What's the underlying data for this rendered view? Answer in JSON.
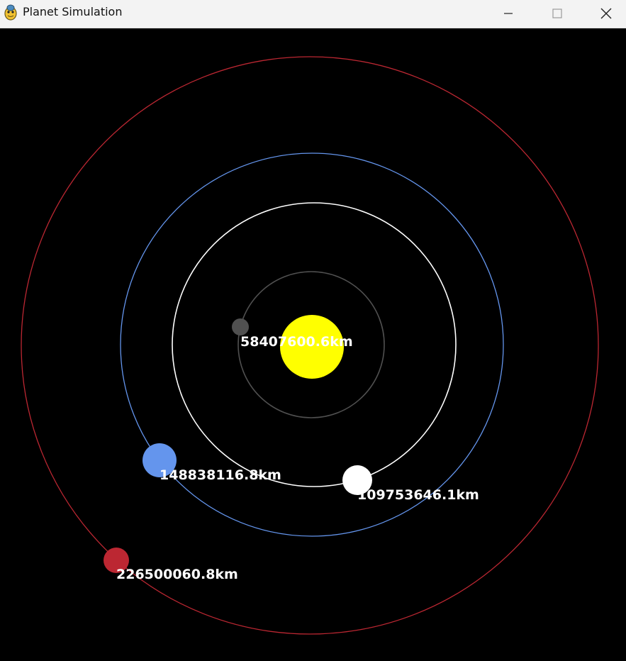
{
  "window": {
    "title": "Planet Simulation",
    "controls": {
      "minimize": "minimize",
      "maximize": "maximize",
      "close": "close"
    }
  },
  "simulation": {
    "background": "#000000",
    "sun": {
      "color": "#ffff00"
    },
    "planets": [
      {
        "id": "mercury",
        "color": "#505050",
        "orbit_color": "#505050",
        "distance_label": "58407600.6km"
      },
      {
        "id": "venus",
        "color": "#ffffff",
        "orbit_color": "#ffffff",
        "distance_label": "109753646.1km"
      },
      {
        "id": "earth",
        "color": "#6495ed",
        "orbit_color": "#6495ed",
        "distance_label": "148838116.8km"
      },
      {
        "id": "mars",
        "color": "#bc2732",
        "orbit_color": "#bc2732",
        "distance_label": "226500060.8km"
      }
    ]
  }
}
